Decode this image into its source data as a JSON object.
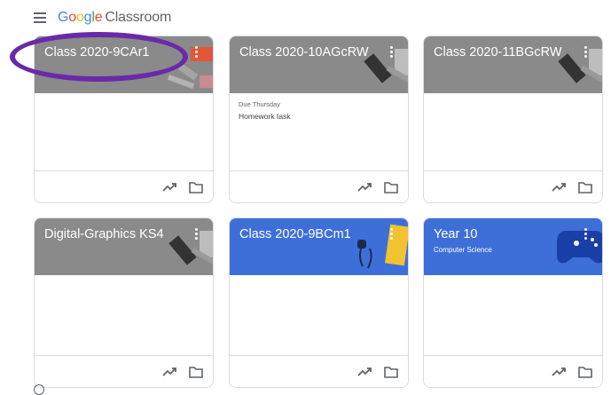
{
  "header": {
    "logo_google": [
      "G",
      "o",
      "o",
      "g",
      "l",
      "e"
    ],
    "logo_product": "Classroom"
  },
  "colors": {
    "gray_header": "#8a8a8a",
    "blue_header": "#3e6fd9",
    "highlight_ring": "#6a2aa8"
  },
  "classes": [
    {
      "title": "Class 2020-9CAr1",
      "subtitle": "",
      "due_label": "",
      "due_task": ""
    },
    {
      "title": "Class 2020-10AGcRW",
      "subtitle": "",
      "due_label": "Due Thursday",
      "due_task": "Homework task"
    },
    {
      "title": "Class 2020-11BGcRW",
      "subtitle": "",
      "due_label": "",
      "due_task": ""
    },
    {
      "title": "Digital-Graphics KS4",
      "subtitle": "",
      "due_label": "",
      "due_task": ""
    },
    {
      "title": "Class 2020-9BCm1",
      "subtitle": "",
      "due_label": "",
      "due_task": ""
    },
    {
      "title": "Year 10",
      "subtitle": "Computer Science",
      "due_label": "",
      "due_task": ""
    }
  ]
}
